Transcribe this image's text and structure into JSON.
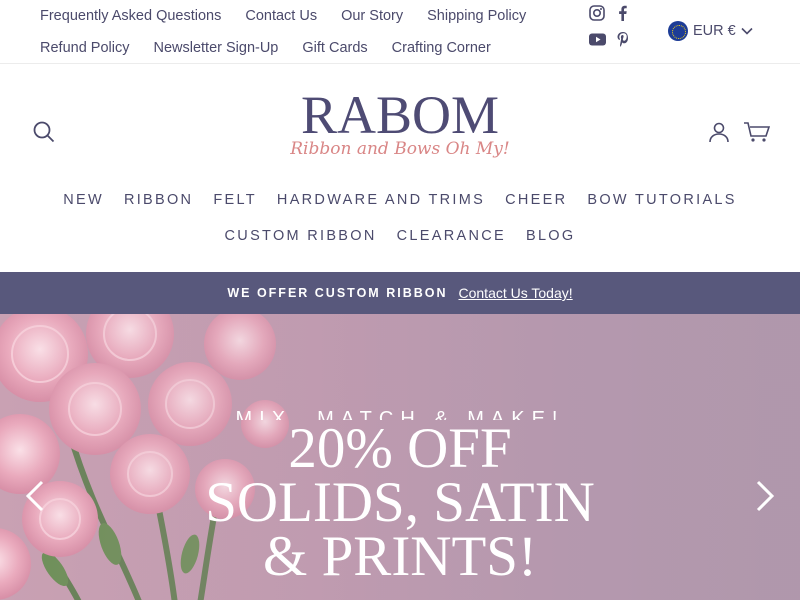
{
  "utility": {
    "row1": [
      "Frequently Asked Questions",
      "Contact Us",
      "Our Story",
      "Shipping Policy"
    ],
    "row2": [
      "Refund Policy",
      "Newsletter Sign-Up",
      "Gift Cards",
      "Crafting Corner"
    ],
    "socials": [
      "instagram-icon",
      "facebook-icon",
      "youtube-icon",
      "pinterest-icon"
    ],
    "currency": "EUR €"
  },
  "header": {
    "logo_main": "RABOM",
    "logo_tagline": "Ribbon and Bows Oh My!",
    "icons": [
      "search-icon",
      "account-icon",
      "cart-icon"
    ]
  },
  "nav": {
    "row1": [
      "NEW",
      "RIBBON",
      "FELT",
      "HARDWARE AND TRIMS",
      "CHEER",
      "BOW TUTORIALS"
    ],
    "row2": [
      "CUSTOM RIBBON",
      "CLEARANCE",
      "BLOG"
    ]
  },
  "announcement": {
    "text": "WE OFFER CUSTOM RIBBON",
    "link": "Contact Us Today!"
  },
  "hero": {
    "kicker": "MIX, MATCH & MAKE!",
    "title_lines": [
      "20% OFF",
      "SOLIDS, SATIN",
      "& PRINTS!"
    ]
  },
  "colors": {
    "text": "#4b4a6b",
    "announcement_bg": "#58587c",
    "logo_tagline": "#d98686",
    "hero_bg": "#bf9aaf"
  }
}
